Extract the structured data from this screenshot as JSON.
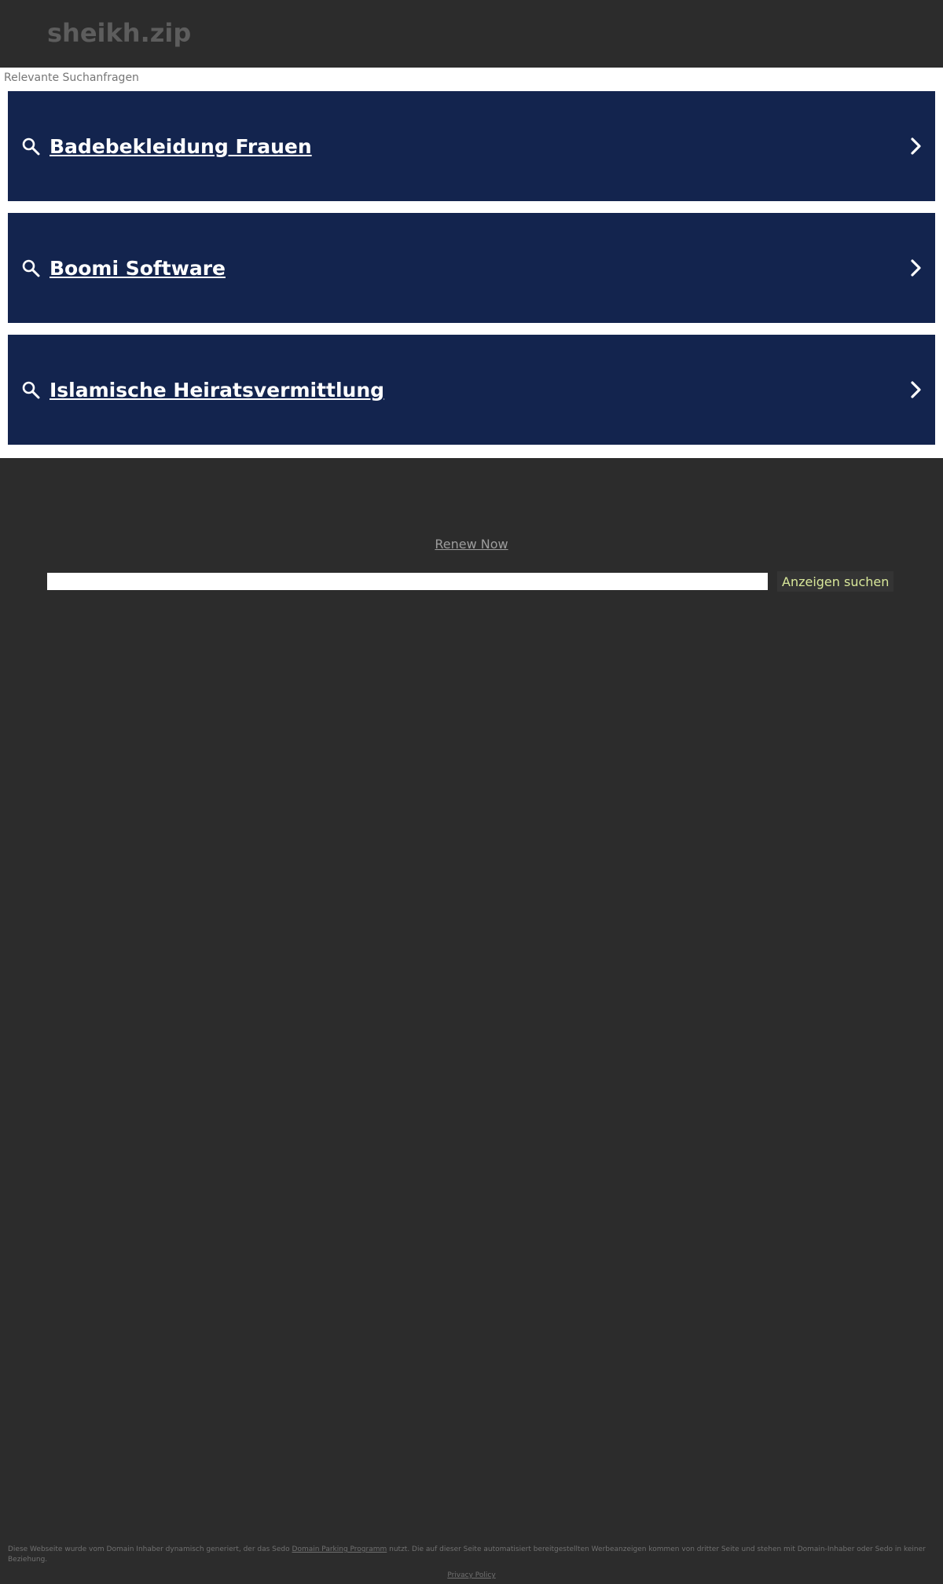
{
  "header": {
    "domain": "sheikh.zip"
  },
  "related": {
    "label": "Relevante Suchanfragen",
    "items": [
      {
        "label": "Badebekleidung Frauen"
      },
      {
        "label": "Boomi Software"
      },
      {
        "label": "Islamische Heiratsvermittlung"
      }
    ]
  },
  "renew": {
    "label": "Renew Now"
  },
  "search": {
    "value": "",
    "button_label": "Anzeigen suchen"
  },
  "footer": {
    "disclaimer_before": "Diese Webseite wurde vom Domain Inhaber dynamisch generiert, der das Sedo ",
    "disclaimer_link": "Domain Parking Programm",
    "disclaimer_after": " nutzt. Die auf dieser Seite automatisiert bereitgestellten Werbeanzeigen kommen von dritter Seite und stehen mit Domain-Inhaber oder Sedo in keiner Beziehung.",
    "privacy_label": "Privacy Policy"
  },
  "colors": {
    "background": "#2c2c2c",
    "ad_block": "#13244e",
    "ad_text": "#ffffff",
    "domain_title": "#5d5d5d",
    "button_text": "#d9e89a"
  },
  "icons": {
    "search": "search-icon",
    "chevron": "chevron-right-icon"
  }
}
